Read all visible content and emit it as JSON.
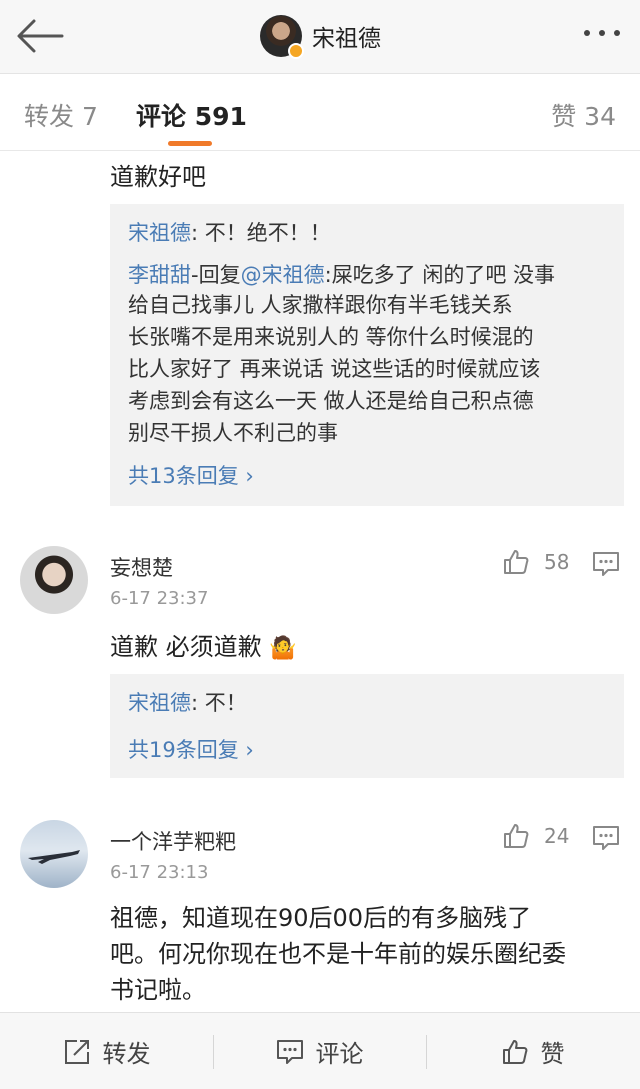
{
  "header": {
    "title": "宋祖德",
    "back_icon": "back-arrow-icon",
    "more_icon": "more-dots-icon"
  },
  "tabs": {
    "repost": "转发 7",
    "comments": "评论 591",
    "likes": "赞 34"
  },
  "comment1": {
    "text": "道歉好吧",
    "replies": [
      {
        "author": "宋祖德",
        "text": ": 不！绝不！！"
      },
      {
        "author": "李甜甜",
        "text_a": "-回复",
        "mention": "@宋祖德",
        "text_b": ":屎吃多了  闲的了吧  没事"
      }
    ],
    "reply_cont": [
      "给自己找事儿    人家撒样跟你有半毛钱关系",
      "长张嘴不是用来说别人的  等你什么时候混的",
      "比人家好了  再来说话    说这些话的时候就应该",
      "考虑到会有这么一天  做人还是给自己积点德",
      "别尽干损人不利己的事"
    ],
    "more_replies": "共13条回复 ›"
  },
  "comment2": {
    "username": "妄想楚",
    "time": "6-17 23:37",
    "likes": "58",
    "text": "道歉  必须道歉",
    "emoji": "🤷",
    "reply": {
      "author": "宋祖德",
      "text": ": 不！"
    },
    "more_replies": "共19条回复 ›"
  },
  "comment3": {
    "username": "一个洋芋粑粑",
    "time": "6-17 23:13",
    "likes": "24",
    "lines": [
      "祖德，知道现在90后00后的有多脑残了",
      "吧。何况你现在也不是十年前的娱乐圈纪委",
      "书记啦。"
    ]
  },
  "bottom": {
    "repost": "转发",
    "comment": "评论",
    "like": "赞"
  },
  "colors": {
    "link": "#4a7cb5",
    "accent": "#f07a2a",
    "reply_bg": "#f2f2f2"
  }
}
